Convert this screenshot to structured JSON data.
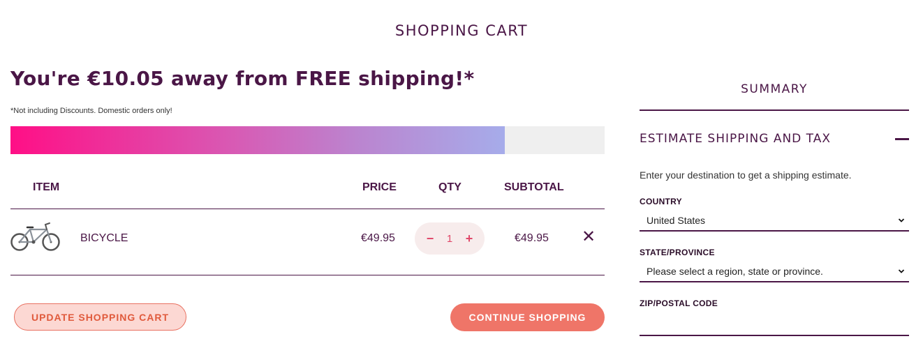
{
  "page": {
    "title": "SHOPPING CART"
  },
  "shipping_promo": {
    "heading": "You're €10.05 away from FREE shipping!*",
    "note": "*Not including Discounts. Domestic orders only!",
    "progress_fraction": 0.832
  },
  "cart": {
    "headers": {
      "item": "ITEM",
      "price": "PRICE",
      "qty": "QTY",
      "subtotal": "SUBTOTAL"
    },
    "items": [
      {
        "name": "BICYCLE",
        "price": "€49.95",
        "qty": "1",
        "subtotal": "€49.95"
      }
    ],
    "qty_decrease": "−",
    "qty_increase": "+",
    "remove_symbol": "✕"
  },
  "buttons": {
    "update": "UPDATE SHOPPING CART",
    "continue": "CONTINUE SHOPPING"
  },
  "summary": {
    "title": "SUMMARY",
    "estimate_title": "ESTIMATE SHIPPING AND TAX",
    "estimate_desc": "Enter your destination to get a shipping estimate.",
    "country_label": "COUNTRY",
    "country_value": "United States",
    "state_label": "STATE/PROVINCE",
    "state_value": "Please select a region, state or province.",
    "zip_label": "ZIP/POSTAL CODE",
    "zip_value": ""
  },
  "icons": {
    "product_image": "bicycle-icon",
    "remove": "close-icon",
    "collapse": "minus-icon",
    "dropdown": "chevron-down-icon"
  }
}
